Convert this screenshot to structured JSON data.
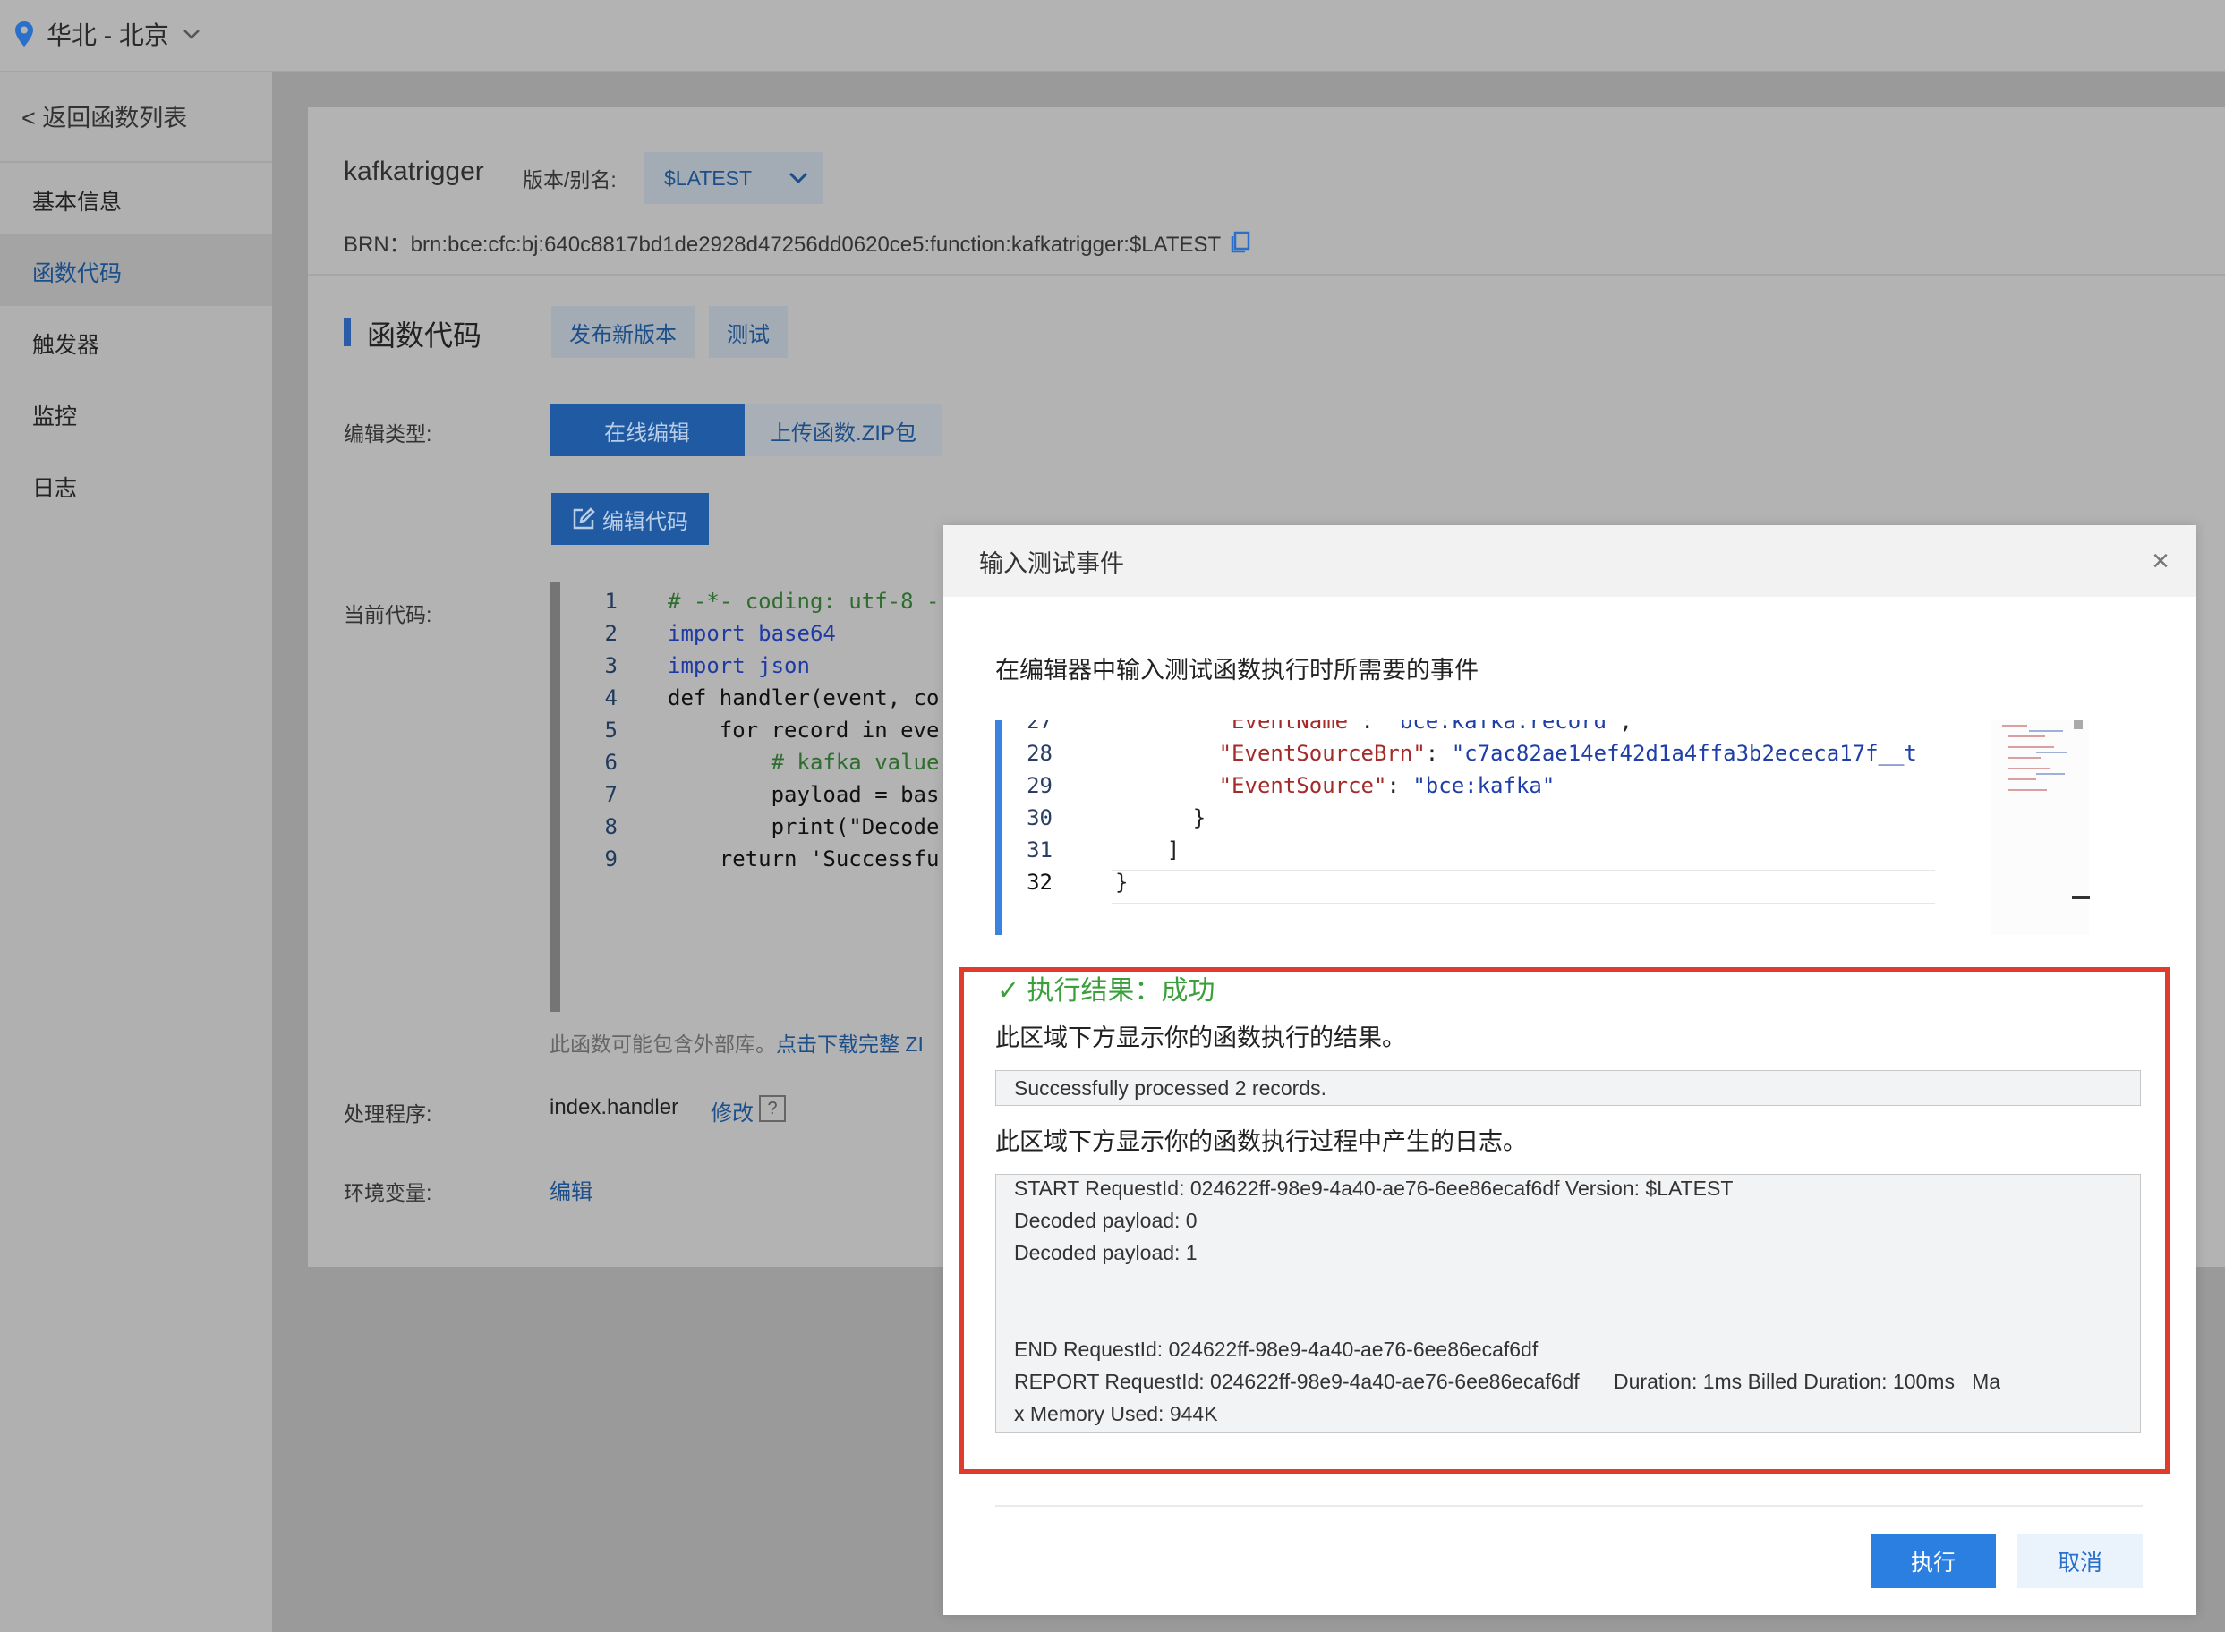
{
  "topbar": {
    "region": "华北 - 北京"
  },
  "sidebar": {
    "back": "< 返回函数列表",
    "items": [
      {
        "label": "基本信息"
      },
      {
        "label": "函数代码"
      },
      {
        "label": "触发器"
      },
      {
        "label": "监控"
      },
      {
        "label": "日志"
      }
    ],
    "active_index": 1
  },
  "header": {
    "function_name": "kafkatrigger",
    "version_label": "版本/别名:",
    "version_value": "$LATEST",
    "brn": "BRN：brn:bce:cfc:bj:640c8817bd1de2928d47256dd0620ce5:function:kafkatrigger:$LATEST"
  },
  "section": {
    "title": "函数代码",
    "publish_button": "发布新版本",
    "test_button": "测试",
    "edit_type_label": "编辑类型:",
    "tab_online": "在线编辑",
    "tab_zip": "上传函数.ZIP包",
    "edit_code_button": "编辑代码",
    "current_code_label": "当前代码:",
    "code_lines": [
      {
        "n": "1",
        "text": "# -*- coding: utf-8 -"
      },
      {
        "n": "2",
        "text": "import base64"
      },
      {
        "n": "3",
        "text": "import json"
      },
      {
        "n": "4",
        "text": "def handler(event, co"
      },
      {
        "n": "5",
        "text": "    for record in eve"
      },
      {
        "n": "6",
        "text": "        # kafka value"
      },
      {
        "n": "7",
        "text": "        payload = bas"
      },
      {
        "n": "8",
        "text": "        print(\"Decode"
      },
      {
        "n": "9",
        "text": "    return 'Successfu"
      }
    ],
    "note_text": "此函数可能包含外部库。",
    "note_link": "点击下载完整 ZI",
    "handler_label": "处理程序:",
    "handler_value": "index.handler",
    "handler_edit": "修改",
    "handler_help": "?",
    "env_label": "环境变量:",
    "env_edit": "编辑"
  },
  "modal": {
    "title": "输入测试事件",
    "close": "×",
    "description": "在编辑器中输入测试函数执行时所需要的事件",
    "editor_lines": [
      {
        "n": "27",
        "indent": "        ",
        "key": "\"EventName\"",
        "sep": ": ",
        "val": "\"bce:kafka:record\"",
        "tail": ","
      },
      {
        "n": "28",
        "indent": "        ",
        "key": "\"EventSourceBrn\"",
        "sep": ": ",
        "val": "\"c7ac82ae14ef42d1a4ffa3b2ececa17f__t",
        "tail": ""
      },
      {
        "n": "29",
        "indent": "        ",
        "key": "\"EventSource\"",
        "sep": ": ",
        "val": "\"bce:kafka\"",
        "tail": ""
      },
      {
        "n": "30",
        "indent": "      ",
        "key": "",
        "sep": "",
        "val": "",
        "tail": "}"
      },
      {
        "n": "31",
        "indent": "    ",
        "key": "",
        "sep": "",
        "val": "",
        "tail": "]"
      },
      {
        "n": "32",
        "indent": "",
        "key": "",
        "sep": "",
        "val": "",
        "tail": "}"
      }
    ],
    "result_title": "✓ 执行结果：成功",
    "result_label": "此区域下方显示你的函数执行的结果。",
    "result_output": "Successfully processed 2 records.",
    "log_label": "此区域下方显示你的函数执行过程中产生的日志。",
    "log_lines": [
      "START RequestId: 024622ff-98e9-4a40-ae76-6ee86ecaf6df Version: $LATEST",
      "Decoded payload: 0",
      "Decoded payload: 1",
      "",
      "",
      "END RequestId: 024622ff-98e9-4a40-ae76-6ee86ecaf6df",
      "REPORT RequestId: 024622ff-98e9-4a40-ae76-6ee86ecaf6df      Duration: 1ms Billed Duration: 100ms   Ma",
      "x Memory Used: 944K"
    ],
    "run_button": "执行",
    "cancel_button": "取消"
  }
}
